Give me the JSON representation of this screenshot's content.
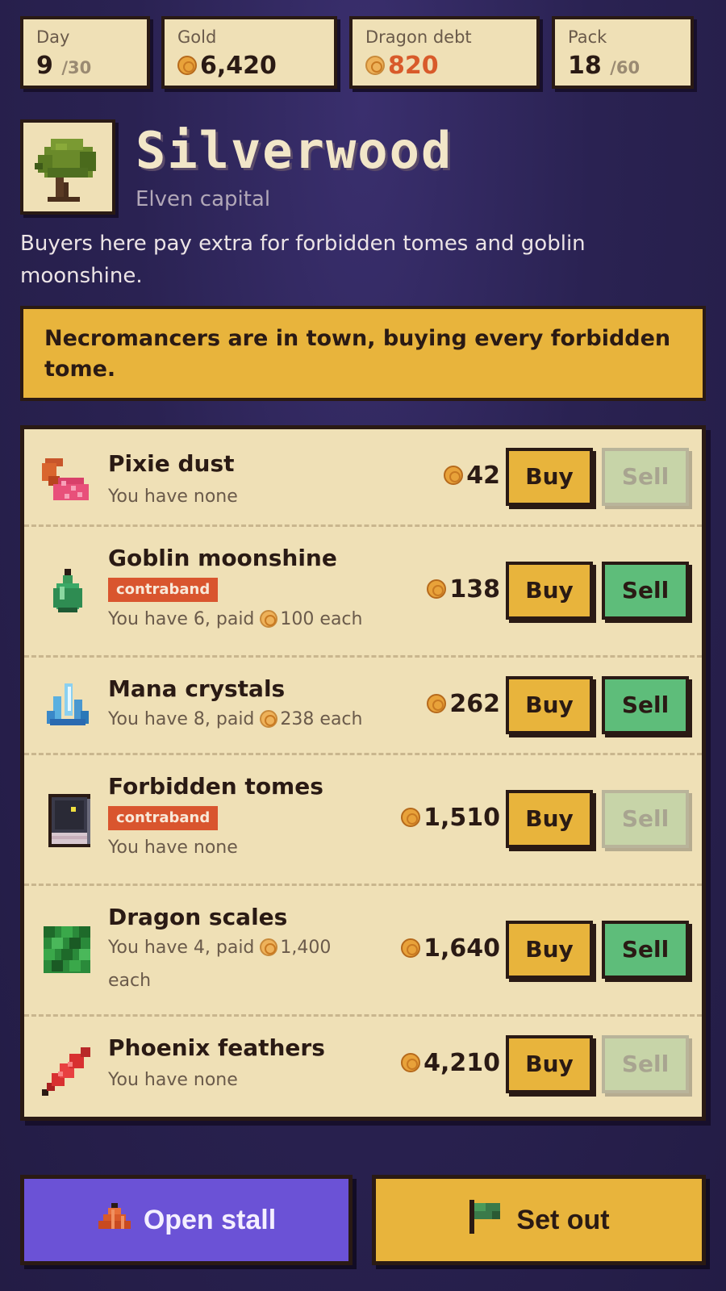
{
  "stats": {
    "day": {
      "label": "Day",
      "value": "9",
      "max": "/30"
    },
    "gold": {
      "label": "Gold",
      "value": "6,420"
    },
    "debt": {
      "label": "Dragon debt",
      "value": "820"
    },
    "pack": {
      "label": "Pack",
      "value": "18",
      "max": "/60"
    }
  },
  "town": {
    "name": "Silverwood",
    "subtitle": "Elven capital",
    "description": "Buyers here pay extra for forbidden tomes and goblin moonshine.",
    "icon": "tree-icon"
  },
  "event": "Necromancers are in town, buying every forbidden tome.",
  "market": {
    "buy_label": "Buy",
    "sell_label": "Sell",
    "items": [
      {
        "name": "Pixie dust",
        "icon": "pixie-dust-icon",
        "price": "42",
        "owned_text": "You have none",
        "sell_enabled": false
      },
      {
        "name": "Goblin moonshine",
        "icon": "moonshine-bottle-icon",
        "badge": "contraband",
        "price": "138",
        "owned_text": "You have 6, paid",
        "paid": "100",
        "paid_suffix": "each",
        "sell_enabled": true
      },
      {
        "name": "Mana crystals",
        "icon": "crystal-icon",
        "price": "262",
        "owned_text": "You have 8, paid",
        "paid": "238",
        "paid_suffix": "each",
        "sell_enabled": true
      },
      {
        "name": "Forbidden tomes",
        "icon": "tome-icon",
        "badge": "contraband",
        "price": "1,510",
        "owned_text": "You have none",
        "sell_enabled": false
      },
      {
        "name": "Dragon scales",
        "icon": "dragon-scale-icon",
        "price": "1,640",
        "owned_text": "You have 4, paid",
        "paid": "1,400",
        "paid_suffix": "each",
        "sell_enabled": true
      },
      {
        "name": "Phoenix feathers",
        "icon": "feather-icon",
        "price": "4,210",
        "owned_text": "You have none",
        "sell_enabled": false
      }
    ]
  },
  "actions": {
    "open_stall": {
      "label": "Open stall",
      "icon": "tent-icon"
    },
    "set_out": {
      "label": "Set out",
      "icon": "flag-icon"
    }
  },
  "colors": {
    "background": "#2a2252",
    "panel": "#efe0b6",
    "gold_button": "#e8b43c",
    "sell_button": "#5ebd7a",
    "contraband": "#d9552e",
    "primary_button": "#6b52d6",
    "debt_text": "#d85a2a"
  }
}
